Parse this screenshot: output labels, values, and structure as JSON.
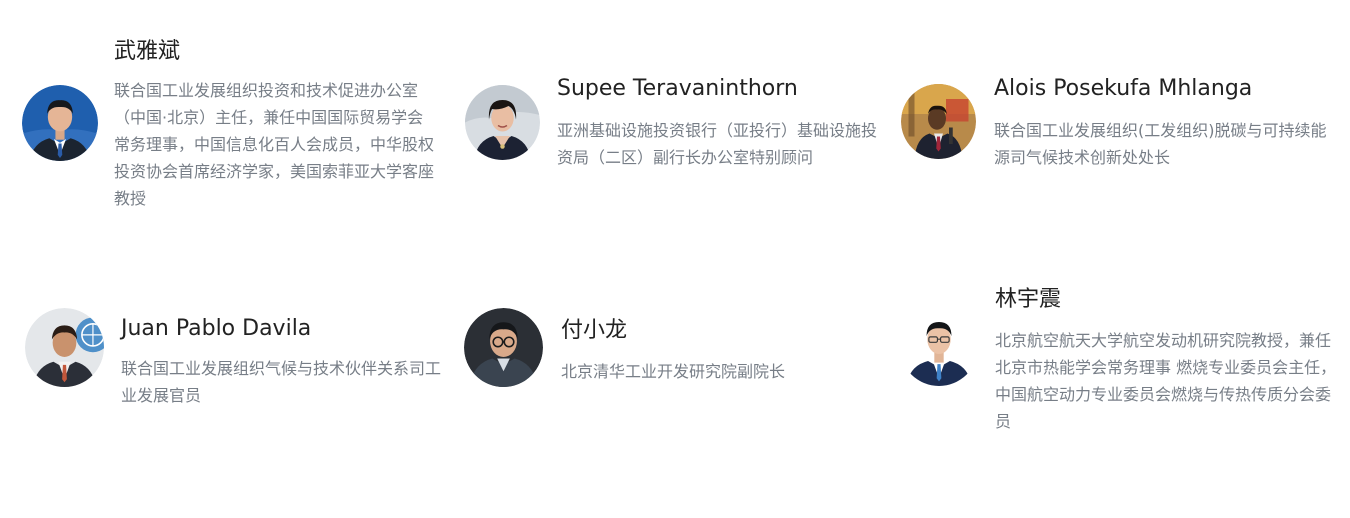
{
  "speakers": [
    {
      "name": "武雅斌",
      "avatar_icon": "portrait-man-suit-icon",
      "description": "联合国工业发展组织投资和技术促进办公室（中国·北京）主任，兼任中国国际贸易学会常务理事，中国信息化百人会成员，中华股权投资协会首席经济学家，美国索菲亚大学客座教授"
    },
    {
      "name": "Supee Teravaninthorn",
      "avatar_icon": "portrait-woman-icon",
      "description": "亚洲基础设施投资银行（亚投行）基础设施投资局（二区）副行长办公室特别顾问"
    },
    {
      "name": "Alois Posekufa Mhlanga",
      "avatar_icon": "portrait-man-speaking-icon",
      "description": "联合国工业发展组织(工发组织)脱碳与可持续能源司气候技术创新处处长"
    },
    {
      "name": "Juan Pablo Davila",
      "avatar_icon": "portrait-man-un-backdrop-icon",
      "description": "联合国工业发展组织气候与技术伙伴关系司工业发展官员"
    },
    {
      "name": "付小龙",
      "avatar_icon": "portrait-man-glasses-icon",
      "description": "北京清华工业开发研究院副院长"
    },
    {
      "name": "林宇震",
      "avatar_icon": "portrait-man-glasses-suit-icon",
      "description": "北京航空航天大学航空发动机研究院教授，兼任北京市热能学会常务理事 燃烧专业委员会主任，中国航空动力专业委员会燃烧与传热传质分会委员"
    }
  ]
}
